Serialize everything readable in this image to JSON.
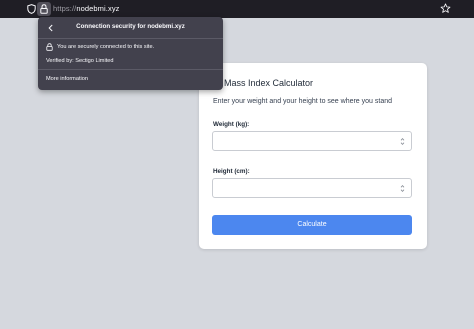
{
  "browser": {
    "url_scheme": "https://",
    "url_host": "nodebmi.xyz",
    "icons": [
      "shield-icon",
      "lock-icon",
      "star-icon"
    ]
  },
  "security_popup": {
    "title": "Connection security for nodebmi.xyz",
    "secure_text": "You are securely connected to this site.",
    "verified_text": "Verified by: Sectigo Limited",
    "more_info_label": "More information"
  },
  "bmi_form": {
    "title": "dy Mass Index Calculator",
    "subtitle": "Enter your weight and your height to see where you stand",
    "weight_label": "Weight (kg):",
    "weight_value": "",
    "height_label": "Height (cm):",
    "height_value": "",
    "calculate_label": "Calculate"
  },
  "colors": {
    "page_bg": "#d5d8de",
    "toolbar_bg": "#1f1e25",
    "popup_bg": "#42414d",
    "accent_button": "#4c87ef"
  }
}
